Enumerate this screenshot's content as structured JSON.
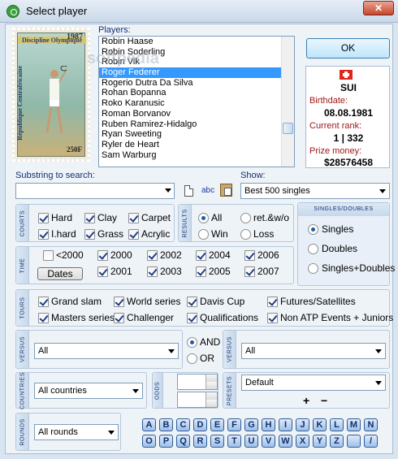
{
  "window": {
    "title": "Select player",
    "close_label": "✕"
  },
  "stamp": {
    "header": "Discipline Olympique",
    "year": "1987",
    "country": "République Centrafricaine",
    "value": "250F"
  },
  "players": {
    "label": "Players:",
    "items": [
      "Robin Haase",
      "Robin Soderling",
      "Robin Vik",
      "Roger Federer",
      "Rogerio Dutra Da Silva",
      "Rohan Bopanna",
      "Roko Karanusic",
      "Roman Borvanov",
      "Ruben Ramirez-Hidalgo",
      "Ryan Sweeting",
      "Ryler de Heart",
      "Sam Warburg"
    ],
    "selected_index": 3
  },
  "ok_label": "OK",
  "info": {
    "country": "SUI",
    "birthdate_label": "Birthdate:",
    "birthdate": "08.08.1981",
    "rank_label": "Current rank:",
    "rank": "1  |  332",
    "prize_label": "Prize money:",
    "prize": "$28576458"
  },
  "search": {
    "label": "Substring to search:",
    "value": "",
    "abc_label": "abc"
  },
  "show": {
    "label": "Show:",
    "value": "Best 500 singles"
  },
  "courts": {
    "title": "COURTS",
    "items": [
      {
        "label": "Hard",
        "checked": true
      },
      {
        "label": "Clay",
        "checked": true
      },
      {
        "label": "Carpet",
        "checked": true
      },
      {
        "label": "I.hard",
        "checked": true
      },
      {
        "label": "Grass",
        "checked": true
      },
      {
        "label": "Acrylic",
        "checked": true
      }
    ]
  },
  "results": {
    "title": "RESULTS",
    "items": [
      {
        "label": "All",
        "selected": true
      },
      {
        "label": "ret.&w/o",
        "selected": false
      },
      {
        "label": "Win",
        "selected": false
      },
      {
        "label": "Loss",
        "selected": false
      }
    ]
  },
  "singles_doubles": {
    "title": "SINGLES/DOUBLES",
    "items": [
      {
        "label": "Singles",
        "selected": true
      },
      {
        "label": "Doubles",
        "selected": false
      },
      {
        "label": "Singles+Doubles",
        "selected": false
      }
    ]
  },
  "time": {
    "title": "TIME",
    "items": [
      {
        "label": "<2000",
        "checked": false
      },
      {
        "label": "2000",
        "checked": true
      },
      {
        "label": "2002",
        "checked": true
      },
      {
        "label": "2004",
        "checked": true
      },
      {
        "label": "2006",
        "checked": true
      },
      {
        "label": "2001",
        "checked": true
      },
      {
        "label": "2003",
        "checked": true
      },
      {
        "label": "2005",
        "checked": true
      },
      {
        "label": "2007",
        "checked": true
      }
    ],
    "dates_label": "Dates"
  },
  "tours": {
    "title": "TOURS",
    "items": [
      {
        "label": "Grand slam",
        "checked": true
      },
      {
        "label": "World series",
        "checked": true
      },
      {
        "label": "Davis Cup",
        "checked": true
      },
      {
        "label": "Futures/Satellites",
        "checked": true
      },
      {
        "label": "Masters series",
        "checked": true
      },
      {
        "label": "Challenger",
        "checked": true
      },
      {
        "label": "Qualifications",
        "checked": true
      },
      {
        "label": "Non ATP Events + Juniors",
        "checked": true
      }
    ]
  },
  "versus": {
    "title": "VERSUS",
    "left_value": "All",
    "right_value": "All",
    "and_label": "AND",
    "or_label": "OR",
    "mode": "AND"
  },
  "countries": {
    "title": "COUNTRIES",
    "value": "All countries"
  },
  "odds": {
    "title": "ODDS",
    "from": "",
    "to": ""
  },
  "presets": {
    "title": "PRESETS",
    "value": "Default",
    "add_label": "+",
    "remove_label": "−"
  },
  "rounds": {
    "title": "ROUNDS",
    "value": "All rounds"
  },
  "alphabet": [
    "A",
    "B",
    "C",
    "D",
    "E",
    "F",
    "G",
    "H",
    "I",
    "J",
    "K",
    "L",
    "M",
    "N",
    "O",
    "P",
    "Q",
    "R",
    "S",
    "T",
    "U",
    "V",
    "W",
    "X",
    "Y",
    "Z",
    "",
    "/"
  ],
  "colors": {
    "accent": "#3399ff",
    "info_label": "#a01818",
    "group_label": "#103070"
  },
  "watermark": "softpedia"
}
